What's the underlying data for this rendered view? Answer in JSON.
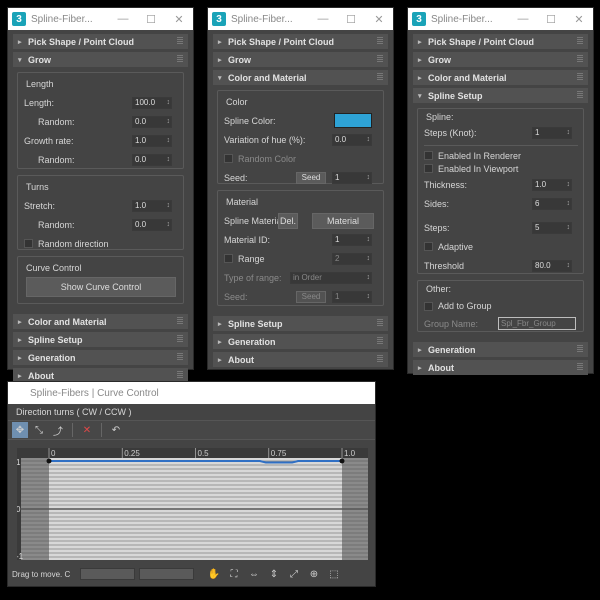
{
  "app": {
    "icon": "3",
    "window_title": "Spline-Fiber...",
    "curve_window_title": "Spline-Fibers | Curve Control"
  },
  "rollouts": {
    "pick_shape": "Pick Shape / Point Cloud",
    "grow": "Grow",
    "color_material": "Color and Material",
    "spline_setup": "Spline Setup",
    "generation": "Generation",
    "about": "About"
  },
  "grow": {
    "length_group": "Length",
    "length_label": "Length:",
    "length_value": "100.0",
    "random_label": "Random:",
    "length_random": "0.0",
    "growth_rate_label": "Growth rate:",
    "growth_rate_value": "1.0",
    "growth_random": "0.0",
    "turns_group": "Turns",
    "stretch_label": "Stretch:",
    "stretch_value": "1.0",
    "stretch_random": "0.0",
    "random_direction": "Random direction",
    "curve_group": "Curve Control",
    "show_curve_button": "Show Curve Control"
  },
  "color": {
    "color_group": "Color",
    "spline_color_label": "Spline Color:",
    "spline_color": "#2ea3d6",
    "variation_label": "Variation of hue (%):",
    "variation_value": "0.0",
    "random_color": "Random Color",
    "seed_label": "Seed:",
    "seed_button": "Seed",
    "seed_value": "1",
    "material_group": "Material",
    "spline_material_label": "Spline Material:",
    "del_button": "Del.",
    "material_button": "Material",
    "material_id_label": "Material ID:",
    "material_id_value": "1",
    "range_label": "Range",
    "range_value": "2",
    "type_of_range_label": "Type of range:",
    "type_of_range_value": "in Order",
    "seed2_label": "Seed:",
    "seed2_button": "Seed",
    "seed2_value": "1"
  },
  "spline": {
    "spline_group": "Spline:",
    "steps_knot_label": "Steps (Knot):",
    "steps_knot_value": "1",
    "enabled_renderer": "Enabled In Renderer",
    "enabled_viewport": "Enabled In Viewport",
    "thickness_label": "Thickness:",
    "thickness_value": "1.0",
    "sides_label": "Sides:",
    "sides_value": "6",
    "steps_label": "Steps:",
    "steps_value": "5",
    "adaptive_label": "Adaptive",
    "threshold_label": "Threshold",
    "threshold_value": "80.0",
    "other_group": "Other:",
    "add_to_group": "Add to Group",
    "group_name_label": "Group Name:",
    "group_name_value": "Spl_Fbr_Group"
  },
  "curve": {
    "header": "Direction turns ( CW / CCW )",
    "x_ticks": [
      "0",
      "0.25",
      "0.5",
      "0.75",
      "1.0"
    ],
    "y_ticks": [
      "1",
      "0",
      "-1"
    ],
    "status": "Drag to move. C",
    "curve_points": [
      {
        "x": 0.0,
        "y": 1.0
      },
      {
        "x": 0.72,
        "y": 1.0
      },
      {
        "x": 0.74,
        "y": 0.97
      },
      {
        "x": 0.83,
        "y": 0.97
      },
      {
        "x": 0.85,
        "y": 1.0
      },
      {
        "x": 1.0,
        "y": 1.0
      }
    ],
    "accent": "#2f6fc4"
  },
  "icons": [
    "close-icon",
    "minimize-icon",
    "maximize-icon",
    "hand-icon",
    "zoom-icon"
  ]
}
